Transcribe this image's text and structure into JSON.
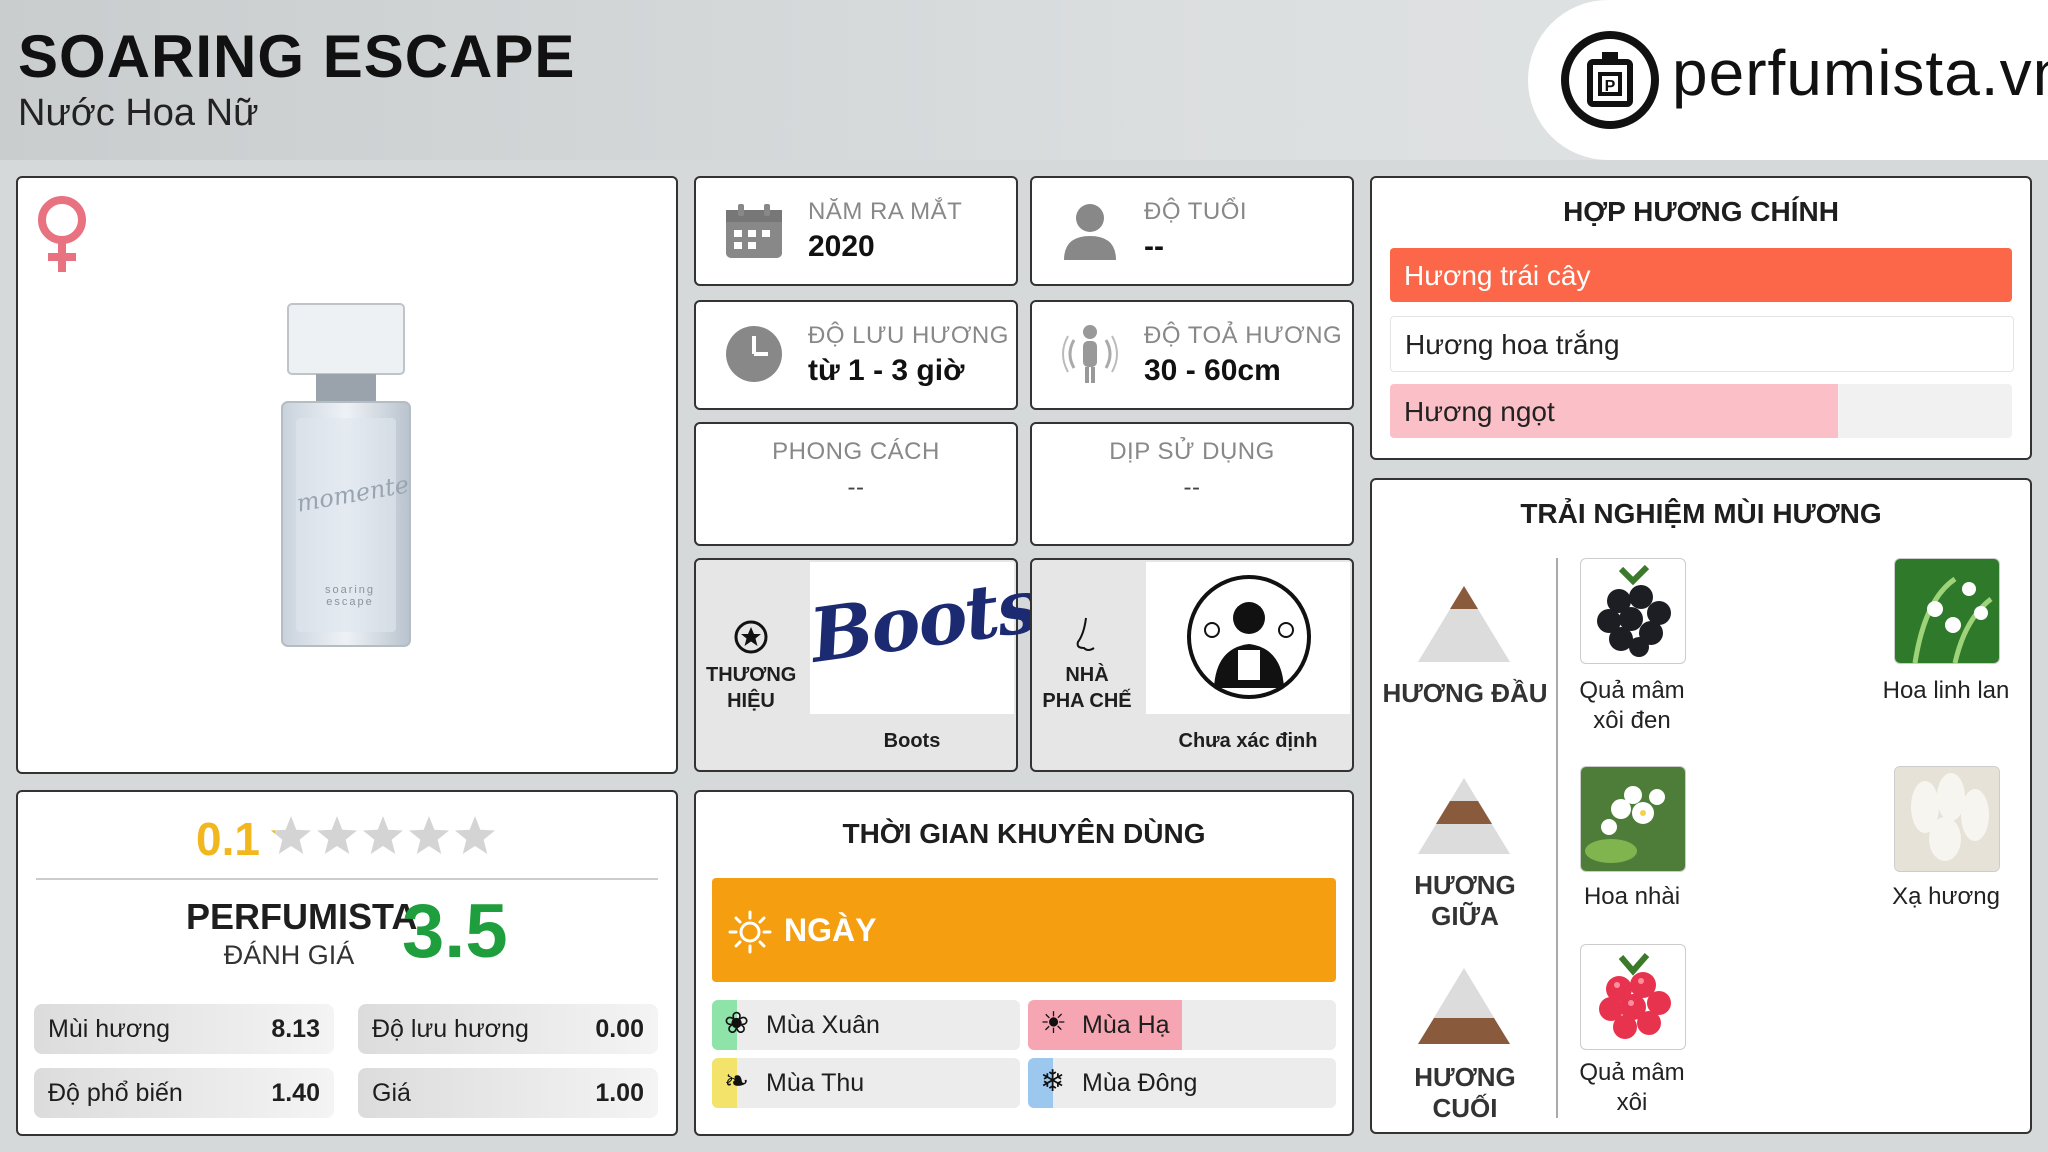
{
  "header": {
    "title": "SOARING ESCAPE",
    "subtitle": "Nước Hoa Nữ",
    "brand_site": "perfumista.vn"
  },
  "info": {
    "release": {
      "label": "NĂM RA MẮT",
      "value": "2020"
    },
    "age": {
      "label": "ĐỘ TUỔI",
      "value": "--"
    },
    "longevity": {
      "label": "ĐỘ LƯU HƯƠNG",
      "value": "từ 1 - 3 giờ"
    },
    "sillage": {
      "label": "ĐỘ TOẢ HƯƠNG",
      "value": "30 - 60cm"
    },
    "style": {
      "label": "PHONG CÁCH",
      "value": "--"
    },
    "occasion": {
      "label": "DỊP SỬ DỤNG",
      "value": "--"
    },
    "brand": {
      "label": "THƯƠNG HIỆU",
      "value": "Boots",
      "logo_text": "Boots"
    },
    "perfumer": {
      "label": "NHÀ PHA CHẾ",
      "value": "Chưa xác định"
    }
  },
  "accords": {
    "title": "HỢP HƯƠNG CHÍNH",
    "items": [
      {
        "label": "Hương trái cây",
        "fill": 1.0,
        "color": "#fb6748",
        "text_color": "#ffffff"
      },
      {
        "label": "Hương hoa trắng",
        "fill": 1.0,
        "color": "#ffffff",
        "text_color": "#222222"
      },
      {
        "label": "Hương ngọt",
        "fill": 0.72,
        "color": "#fbc0c7",
        "text_color": "#222222"
      }
    ]
  },
  "notes": {
    "title": "TRẢI NGHIỆM MÙI HƯƠNG",
    "top": {
      "label": "HƯƠNG ĐẦU",
      "items": [
        "Quả mâm xôi đen",
        "Hoa linh lan"
      ]
    },
    "middle": {
      "label": "HƯƠNG GIỮA",
      "items": [
        "Hoa nhài",
        "Xạ hương"
      ]
    },
    "base": {
      "label": "HƯƠNG CUỐI",
      "items": [
        "Quả mâm xôi"
      ]
    }
  },
  "rating": {
    "user_score": "0.1",
    "stars_filled": 0.1,
    "stars_total": 5,
    "perfumista_label": "PERFUMISTA",
    "perfumista_sub": "ĐÁNH GIÁ",
    "perfumista_score": "3.5",
    "stats": [
      {
        "label": "Mùi hương",
        "value": "8.13"
      },
      {
        "label": "Độ lưu hương",
        "value": "0.00"
      },
      {
        "label": "Độ phổ biến",
        "value": "1.40"
      },
      {
        "label": "Giá",
        "value": "1.00"
      }
    ]
  },
  "time": {
    "title": "THỜI GIAN KHUYÊN DÙNG",
    "day_label": "NGÀY",
    "seasons": [
      {
        "label": "Mùa Xuân",
        "fill": 0.08,
        "color": "#8ee3a8"
      },
      {
        "label": "Mùa Hạ",
        "fill": 0.5,
        "color": "#f6a6b2"
      },
      {
        "label": "Mùa Thu",
        "fill": 0.08,
        "color": "#f3e36a"
      },
      {
        "label": "Mùa Đông",
        "fill": 0.08,
        "color": "#9cc8f0"
      }
    ]
  },
  "colors": {
    "accent_orange": "#f59e10",
    "score_green": "#1e9e3c",
    "score_gold": "#f2b71e",
    "female_pink": "#e8727f"
  },
  "bottle_engraving": "momente",
  "bottle_label": "soaring escape"
}
